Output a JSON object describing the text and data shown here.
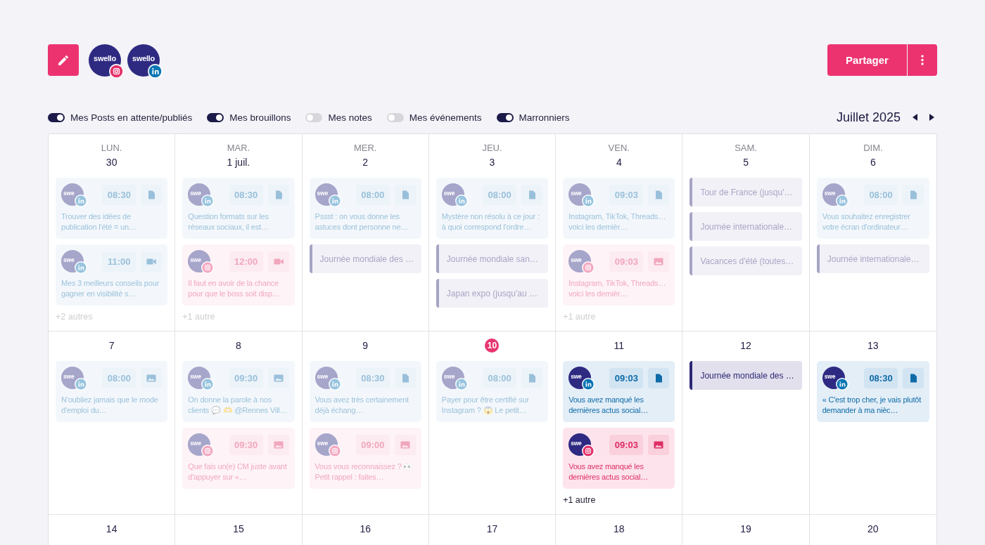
{
  "accounts": [
    {
      "name": "swello",
      "kind": "instagram"
    },
    {
      "name": "swello",
      "kind": "linkedin"
    }
  ],
  "share_button": "Partager",
  "filters": [
    {
      "label": "Mes Posts en attente/publiés",
      "on": true
    },
    {
      "label": "Mes brouillons",
      "on": true
    },
    {
      "label": "Mes notes",
      "on": false
    },
    {
      "label": "Mes événements",
      "on": false
    },
    {
      "label": "Marronniers",
      "on": true
    }
  ],
  "month": "Juillet 2025",
  "calendar": {
    "weekdays": [
      "LUN.",
      "MAR.",
      "MER.",
      "JEU.",
      "VEN.",
      "SAM.",
      "DIM."
    ],
    "weeks": [
      {
        "days": [
          {
            "date": "30",
            "today": false,
            "items": [
              {
                "kind": "post",
                "avatar": "swe",
                "badge": {
                  "kind": "linkedin"
                },
                "time": "08:30",
                "media": {
                  "kind": "document"
                },
                "text": "Trouver des idées de publication l'été = un…",
                "past": true
              },
              {
                "kind": "post",
                "avatar": "swe",
                "badge": {
                  "kind": "linkedin"
                },
                "time": "11:00",
                "media": {
                  "kind": "video"
                },
                "text": "Mes 3 meilleurs conseils pour gagner en visibilité s…",
                "past": true
              }
            ],
            "more": {
              "label": "+2 autres",
              "past": true
            }
          },
          {
            "date": "1 juil.",
            "today": false,
            "items": [
              {
                "kind": "post",
                "avatar": "swe",
                "badge": {
                  "kind": "linkedin"
                },
                "time": "08:30",
                "media": {
                  "kind": "document"
                },
                "text": "Question formats sur les réseaux sociaux, il est…",
                "past": true
              },
              {
                "kind": "post",
                "avatar": "swe",
                "badge": {
                  "kind": "instagram"
                },
                "time": "12:00",
                "media": {
                  "kind": "video"
                },
                "text": "Il faut en avoir de la chance pour que le boss soit disp…",
                "past": true
              }
            ],
            "more": {
              "label": "+1 autre",
              "past": true
            }
          },
          {
            "date": "2",
            "today": false,
            "items": [
              {
                "kind": "post",
                "avatar": "swe",
                "badge": {
                  "kind": "linkedin"
                },
                "time": "08:00",
                "media": {
                  "kind": "document"
                },
                "text": "Pssst : on vous donne les astuces dont personne ne…",
                "past": true
              },
              {
                "kind": "event",
                "title": "Journée mondiale des …",
                "past": true
              }
            ]
          },
          {
            "date": "3",
            "today": false,
            "items": [
              {
                "kind": "post",
                "avatar": "swe",
                "badge": {
                  "kind": "linkedin"
                },
                "time": "08:00",
                "media": {
                  "kind": "document"
                },
                "text": "Mystère non résolu à ce jour : à quoi correspond l'ordre…",
                "past": true
              },
              {
                "kind": "event",
                "title": "Journée mondiale san…",
                "past": true
              },
              {
                "kind": "event",
                "title": "Japan expo (jusqu'au …",
                "past": true
              }
            ]
          },
          {
            "date": "4",
            "today": false,
            "items": [
              {
                "kind": "post",
                "avatar": "swe",
                "badge": {
                  "kind": "linkedin"
                },
                "time": "09:03",
                "media": {
                  "kind": "document"
                },
                "text": "Instagram, TikTok, Threads… voici les dernièr…",
                "past": true
              },
              {
                "kind": "post",
                "avatar": "swe",
                "badge": {
                  "kind": "instagram"
                },
                "time": "09:03",
                "media": {
                  "kind": "image"
                },
                "text": "Instagram, TikTok, Threads… voici les dernièr…",
                "past": true
              }
            ],
            "more": {
              "label": "+1 autre",
              "past": true
            }
          },
          {
            "date": "5",
            "today": false,
            "items": [
              {
                "kind": "event",
                "title": "Tour de France (jusqu'…",
                "past": true
              },
              {
                "kind": "event",
                "title": "Journée internationale…",
                "past": true
              },
              {
                "kind": "event",
                "title": "Vacances d'été (toutes…",
                "past": true
              }
            ]
          },
          {
            "date": "6",
            "today": false,
            "items": [
              {
                "kind": "post",
                "avatar": "swe",
                "badge": {
                  "kind": "linkedin"
                },
                "time": "08:00",
                "media": {
                  "kind": "document"
                },
                "text": "Vous souhaitez enregistrer votre écran d'ordinateur…",
                "past": true
              },
              {
                "kind": "event",
                "title": "Journée internationale…",
                "past": true
              }
            ]
          }
        ]
      },
      {
        "days": [
          {
            "date": "7",
            "today": false,
            "items": [
              {
                "kind": "post",
                "avatar": "swe",
                "badge": {
                  "kind": "linkedin"
                },
                "time": "08:00",
                "media": {
                  "kind": "image"
                },
                "text": "N'oubliez jamais que le mode d'emploi du…",
                "past": true
              }
            ]
          },
          {
            "date": "8",
            "today": false,
            "items": [
              {
                "kind": "post",
                "avatar": "swe",
                "badge": {
                  "kind": "linkedin"
                },
                "time": "09:30",
                "media": {
                  "kind": "image"
                },
                "text": "On donne la parole à nos clients 💬 🫶 @Rennes Vill…",
                "past": true
              },
              {
                "kind": "post",
                "avatar": "swe",
                "badge": {
                  "kind": "instagram"
                },
                "time": "09:30",
                "media": {
                  "kind": "image"
                },
                "text": "Que fais un(e) CM juste avant d'appuyer sur «…",
                "past": true
              }
            ]
          },
          {
            "date": "9",
            "today": false,
            "items": [
              {
                "kind": "post",
                "avatar": "swe",
                "badge": {
                  "kind": "linkedin"
                },
                "time": "08:30",
                "media": {
                  "kind": "document"
                },
                "text": "Vous avez très certainement déjà échang…",
                "past": true
              },
              {
                "kind": "post",
                "avatar": "swe",
                "badge": {
                  "kind": "instagram"
                },
                "time": "09:00",
                "media": {
                  "kind": "image"
                },
                "text": "Vous vous reconnaissez ? 👀 Petit rappel : faites…",
                "past": true
              }
            ]
          },
          {
            "date": "10",
            "today": true,
            "items": [
              {
                "kind": "post",
                "avatar": "swe",
                "badge": {
                  "kind": "linkedin"
                },
                "time": "08:00",
                "media": {
                  "kind": "document"
                },
                "text": "Payer pour être certifié sur Instagram ? 😱 Le petit…",
                "past": true
              }
            ]
          },
          {
            "date": "11",
            "today": false,
            "items": [
              {
                "kind": "post",
                "avatar": "swe",
                "badge": {
                  "kind": "linkedin"
                },
                "time": "09:03",
                "media": {
                  "kind": "document"
                },
                "text": "Vous avez manqué les dernières actus social…",
                "past": false
              },
              {
                "kind": "post",
                "avatar": "swe",
                "badge": {
                  "kind": "instagram"
                },
                "time": "09:03",
                "media": {
                  "kind": "image"
                },
                "text": "Vous avez manqué les dernières actus social…",
                "past": false
              }
            ],
            "more": {
              "label": "+1 autre",
              "past": false
            }
          },
          {
            "date": "12",
            "today": false,
            "items": [
              {
                "kind": "event",
                "title": "Journée mondiale des …",
                "past": false
              }
            ]
          },
          {
            "date": "13",
            "today": false,
            "items": [
              {
                "kind": "post",
                "avatar": "swe",
                "badge": {
                  "kind": "linkedin"
                },
                "time": "08:30",
                "media": {
                  "kind": "document"
                },
                "text": "« C'est trop cher, je vais plutôt demander à ma nièc…",
                "past": false
              }
            ]
          }
        ]
      },
      {
        "days": [
          {
            "date": "14",
            "today": false
          },
          {
            "date": "15",
            "today": false
          },
          {
            "date": "16",
            "today": false
          },
          {
            "date": "17",
            "today": false
          },
          {
            "date": "18",
            "today": false
          },
          {
            "date": "19",
            "today": false
          },
          {
            "date": "20",
            "today": false
          }
        ]
      }
    ]
  }
}
